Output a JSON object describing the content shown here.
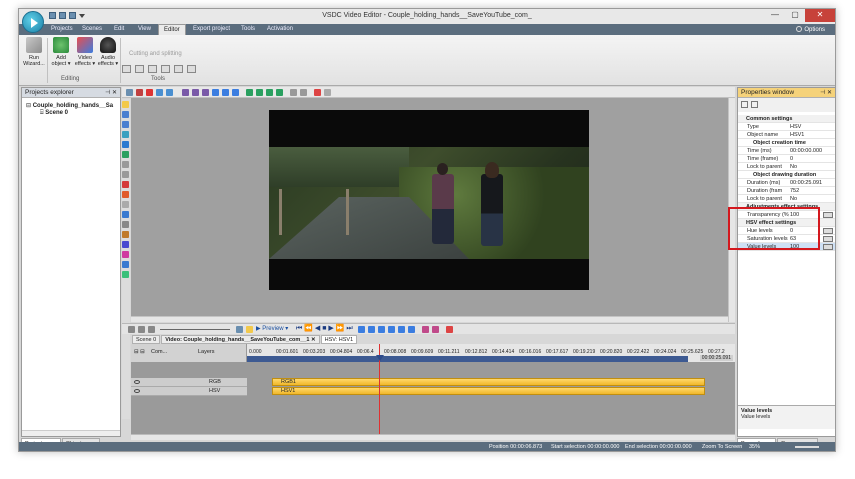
{
  "window": {
    "title": "VSDC Video Editor - Couple_holding_hands__SaveYouTube_com_",
    "min_glyph": "—",
    "max_glyph": "▢",
    "close_glyph": "✕"
  },
  "ribbon_tabs": [
    "Projects",
    "Scenes",
    "Edit",
    "View",
    "Editor",
    "Export project",
    "Tools",
    "Activation"
  ],
  "options_label": "Options",
  "ribbon": {
    "run_wizard": "Run Wizard...",
    "add_object": "Add object ▾",
    "video_effects": "Video effects ▾",
    "audio_effects": "Audio effects ▾",
    "editing_group": "Editing",
    "cutting": "Cutting and splitting",
    "tools_group": "Tools"
  },
  "explorer": {
    "title": "Projects explorer",
    "project_name": "Couple_holding_hands__Sa",
    "scene": "Scene 0",
    "tabs": [
      "Projects ex...",
      "Objects ex..."
    ]
  },
  "timeline": {
    "preview_label": "▶ Preview ▾",
    "tabs": [
      "Scene 0",
      "Video: Couple_holding_hands__SaveYouTube_com__1",
      "HSV: HSV1"
    ],
    "close_glyph": "✕",
    "header_com": "Com...",
    "header_layers": "Layers",
    "ticks": [
      "0.000",
      "00:01.601",
      "00:03.203",
      "00:04.804",
      "00:06.4",
      "00:08.008",
      "00:09.609",
      "00:11.211",
      "00:12.812",
      "00:14.414",
      "00:16.016",
      "00:17.617",
      "00:19.219",
      "00:20.820",
      "00:22.422",
      "00:24.024",
      "00:25.625",
      "00:27.2"
    ],
    "end_time": "00:00:25.091",
    "tracks": [
      {
        "layer": "RGB",
        "clip": "RGB1"
      },
      {
        "layer": "HSV",
        "clip": "HSV1"
      }
    ]
  },
  "properties": {
    "title": "Properties window",
    "rows": [
      {
        "type": "sec",
        "key": "Common settings"
      },
      {
        "key": "Type",
        "value": "HSV"
      },
      {
        "key": "Object name",
        "value": "HSV1"
      },
      {
        "type": "sub",
        "key": "Object creation time"
      },
      {
        "key": "Time (ms)",
        "value": "00:00:00.000"
      },
      {
        "key": "Time (frame)",
        "value": "0"
      },
      {
        "key": "Lock to parent",
        "value": "No"
      },
      {
        "type": "sub",
        "key": "Object drawing duration"
      },
      {
        "key": "Duration (ms)",
        "value": "00:00:25.091"
      },
      {
        "key": "Duration (fram",
        "value": "752"
      },
      {
        "key": "Lock to parent",
        "value": "No"
      },
      {
        "type": "sec",
        "key": "Adjustments effect settings"
      },
      {
        "key": "Transparency (%)",
        "value": "100"
      },
      {
        "type": "sec",
        "key": "HSV effect settings"
      },
      {
        "key": "Hue levels",
        "value": "0"
      },
      {
        "key": "Saturation levels",
        "value": "63"
      },
      {
        "key": "Value levels",
        "value": "100",
        "selected": true
      }
    ],
    "desc_title": "Value levels",
    "desc_text": "Value levels",
    "tabs": [
      "Properties ...",
      "Resources ..."
    ]
  },
  "status": {
    "position": "Position    00:00:06.873",
    "start_sel": "Start selection    00:00:00.000",
    "end_sel": "End selection    00:00:00.000",
    "zoom": "Zoom To Screen",
    "percent": "35%"
  },
  "colors": {
    "ribbon_dark": "#5b6d7e",
    "clip": "#f0b72a",
    "playhead": "#e03030",
    "highlight_box": "#d4181e",
    "props_header": "#f5d27a"
  }
}
